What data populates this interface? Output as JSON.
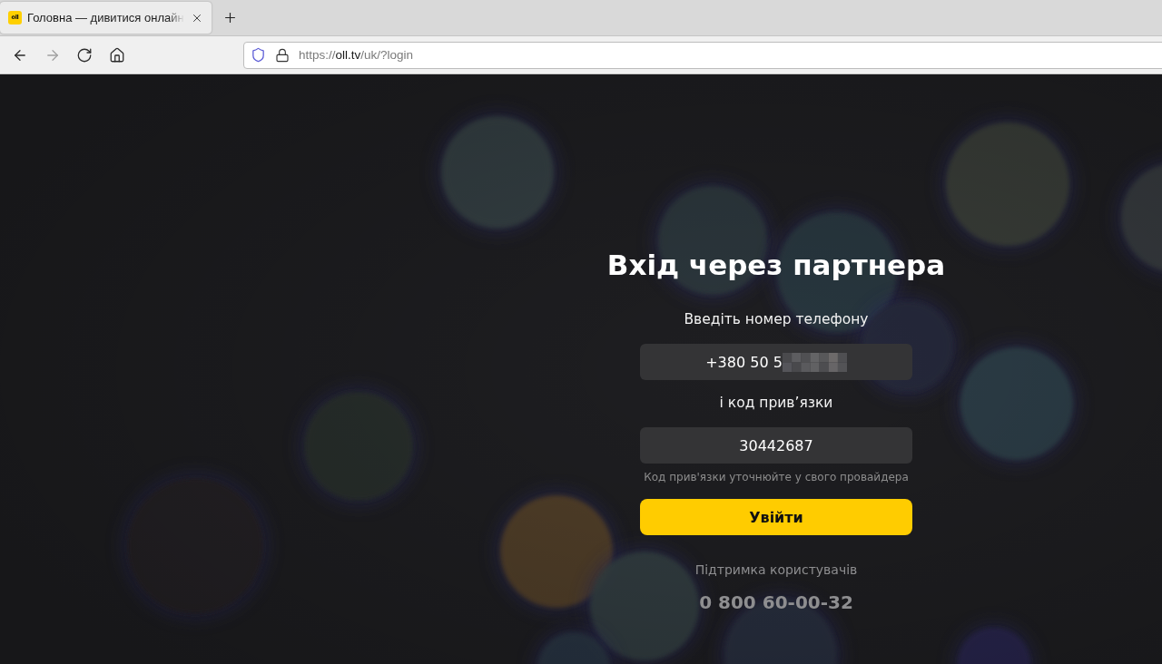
{
  "browser": {
    "tabs": [
      {
        "favicon_text": "oll",
        "title": "Головна — дивитися онлайн",
        "selected": true
      }
    ],
    "nav_buttons": [
      {
        "kind": "back",
        "disabled": false
      },
      {
        "kind": "forward",
        "disabled": true
      },
      {
        "kind": "reload",
        "disabled": false
      },
      {
        "kind": "home",
        "disabled": false
      }
    ],
    "address_bar": {
      "scheme": "https://",
      "host": "oll.tv",
      "path": "/uk/?login"
    }
  },
  "login": {
    "title": "Вхід через партнера",
    "phone_label": "Введіть номер телефону",
    "phone_field": {
      "value": "+380 50 5",
      "redacted": true
    },
    "code_label": "і код прив’язки",
    "code_field": {
      "value": "30442687"
    },
    "hint": "Код прив'язки уточнюйте у свого провайдера",
    "submit_button": "Увійти"
  },
  "support": {
    "label": "Підтримка користувачів",
    "phone": "0 800 60-00-32"
  }
}
